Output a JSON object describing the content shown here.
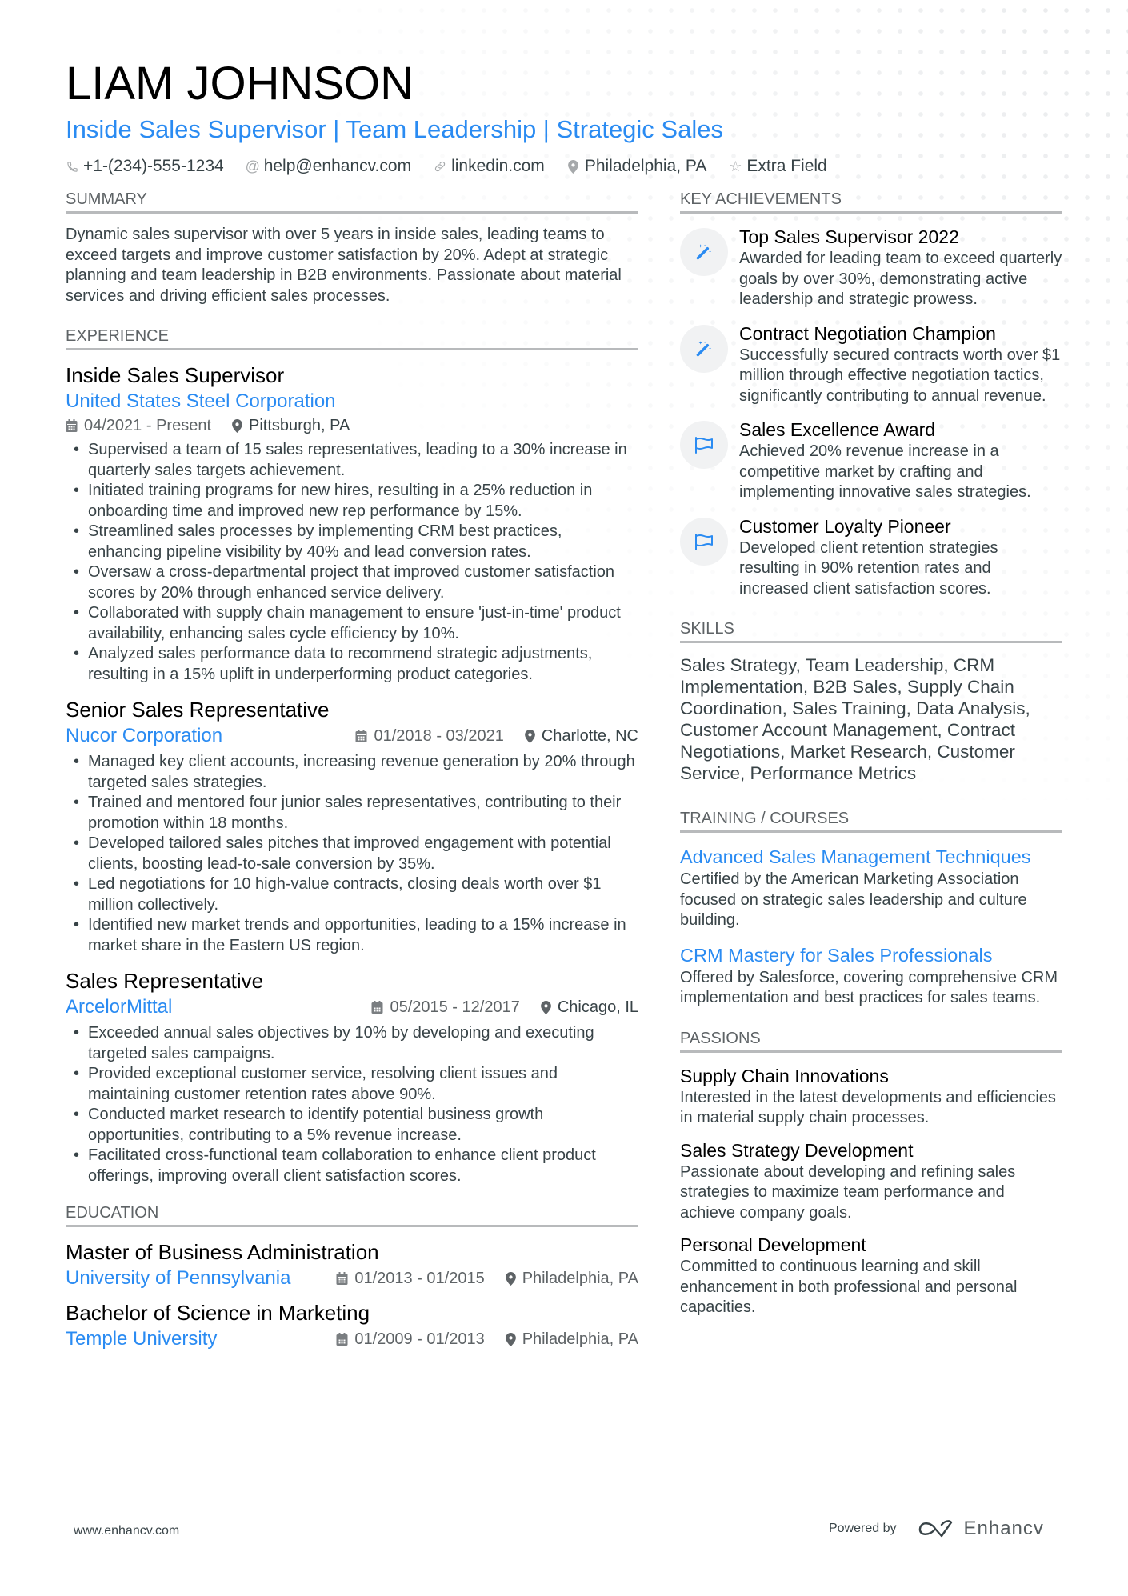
{
  "header": {
    "name": "LIAM JOHNSON",
    "headline": "Inside Sales Supervisor | Team Leadership | Strategic Sales",
    "contacts": [
      {
        "icon": "phone-icon",
        "text": "+1-(234)-555-1234"
      },
      {
        "icon": "at-icon",
        "text": "help@enhancv.com"
      },
      {
        "icon": "link-icon",
        "text": "linkedin.com"
      },
      {
        "icon": "location-pin-icon",
        "text": "Philadelphia, PA"
      },
      {
        "icon": "star-icon",
        "text": "Extra Field"
      }
    ]
  },
  "colors": {
    "accent": "#2a8bf2",
    "text": "#384347",
    "heading": "#000000",
    "rule": "#b8babc"
  },
  "summary": {
    "title": "SUMMARY",
    "text": "Dynamic sales supervisor with over 5 years in inside sales, leading teams to exceed targets and improve customer satisfaction by 20%. Adept at strategic planning and team leadership in B2B environments. Passionate about material services and driving efficient sales processes."
  },
  "experience": {
    "title": "EXPERIENCE",
    "jobs": [
      {
        "title": "Inside Sales Supervisor",
        "company": "United States Steel Corporation",
        "dates": "04/2021 - Present",
        "location": "Pittsburgh, PA",
        "bullets": [
          "Supervised a team of 15 sales representatives, leading to a 30% increase in quarterly sales targets achievement.",
          "Initiated training programs for new hires, resulting in a 25% reduction in onboarding time and improved new rep performance by 15%.",
          "Streamlined sales processes by implementing CRM best practices, enhancing pipeline visibility by 40% and lead conversion rates.",
          "Oversaw a cross-departmental project that improved customer satisfaction scores by 20% through enhanced service delivery.",
          "Collaborated with supply chain management to ensure 'just-in-time' product availability, enhancing sales cycle efficiency by 10%.",
          "Analyzed sales performance data to recommend strategic adjustments, resulting in a 15% uplift in underperforming product categories."
        ]
      },
      {
        "title": "Senior Sales Representative",
        "company": "Nucor Corporation",
        "dates": "01/2018 - 03/2021",
        "location": "Charlotte, NC",
        "bullets": [
          "Managed key client accounts, increasing revenue generation by 20% through targeted sales strategies.",
          "Trained and mentored four junior sales representatives, contributing to their promotion within 18 months.",
          "Developed tailored sales pitches that improved engagement with potential clients, boosting lead-to-sale conversion by 35%.",
          "Led negotiations for 10 high-value contracts, closing deals worth over $1 million collectively.",
          "Identified new market trends and opportunities, leading to a 15% increase in market share in the Eastern US region."
        ]
      },
      {
        "title": "Sales Representative",
        "company": "ArcelorMittal",
        "dates": "05/2015 - 12/2017",
        "location": "Chicago, IL",
        "bullets": [
          "Exceeded annual sales objectives by 10% by developing and executing targeted sales campaigns.",
          "Provided exceptional customer service, resolving client issues and maintaining customer retention rates above 90%.",
          "Conducted market research to identify potential business growth opportunities, contributing to a 5% revenue increase.",
          "Facilitated cross-functional team collaboration to enhance client product offerings, improving overall client satisfaction scores."
        ]
      }
    ]
  },
  "education": {
    "title": "EDUCATION",
    "items": [
      {
        "degree": "Master of Business Administration",
        "school": "University of Pennsylvania",
        "dates": "01/2013 - 01/2015",
        "location": "Philadelphia, PA"
      },
      {
        "degree": "Bachelor of Science in Marketing",
        "school": "Temple University",
        "dates": "01/2009 - 01/2013",
        "location": "Philadelphia, PA"
      }
    ]
  },
  "achievements": {
    "title": "KEY ACHIEVEMENTS",
    "items": [
      {
        "icon": "magic-wand-icon",
        "title": "Top Sales Supervisor 2022",
        "desc": "Awarded for leading team to exceed quarterly goals by over 30%, demonstrating active leadership and strategic prowess."
      },
      {
        "icon": "magic-wand-icon",
        "title": "Contract Negotiation Champion",
        "desc": "Successfully secured contracts worth over $1 million through effective negotiation tactics, significantly contributing to annual revenue."
      },
      {
        "icon": "flag-icon",
        "title": "Sales Excellence Award",
        "desc": "Achieved 20% revenue increase in a competitive market by crafting and implementing innovative sales strategies."
      },
      {
        "icon": "flag-icon",
        "title": "Customer Loyalty Pioneer",
        "desc": "Developed client retention strategies resulting in 90% retention rates and increased client satisfaction scores."
      }
    ]
  },
  "skills": {
    "title": "SKILLS",
    "text": "Sales Strategy, Team Leadership, CRM Implementation, B2B Sales, Supply Chain Coordination, Sales Training, Data Analysis, Customer Account Management, Contract Negotiations, Market Research, Customer Service, Performance Metrics"
  },
  "training": {
    "title": "TRAINING / COURSES",
    "items": [
      {
        "title": "Advanced Sales Management Techniques",
        "desc": "Certified by the American Marketing Association focused on strategic sales leadership and culture building."
      },
      {
        "title": "CRM Mastery for Sales Professionals",
        "desc": "Offered by Salesforce, covering comprehensive CRM implementation and best practices for sales teams."
      }
    ]
  },
  "passions": {
    "title": "PASSIONS",
    "items": [
      {
        "title": "Supply Chain Innovations",
        "desc": "Interested in the latest developments and efficiencies in material supply chain processes."
      },
      {
        "title": "Sales Strategy Development",
        "desc": "Passionate about developing and refining sales strategies to maximize team performance and achieve company goals."
      },
      {
        "title": "Personal Development",
        "desc": "Committed to continuous learning and skill enhancement in both professional and personal capacities."
      }
    ]
  },
  "footer": {
    "website": "www.enhancv.com",
    "powered_by": "Powered by",
    "brand": "Enhancv"
  }
}
